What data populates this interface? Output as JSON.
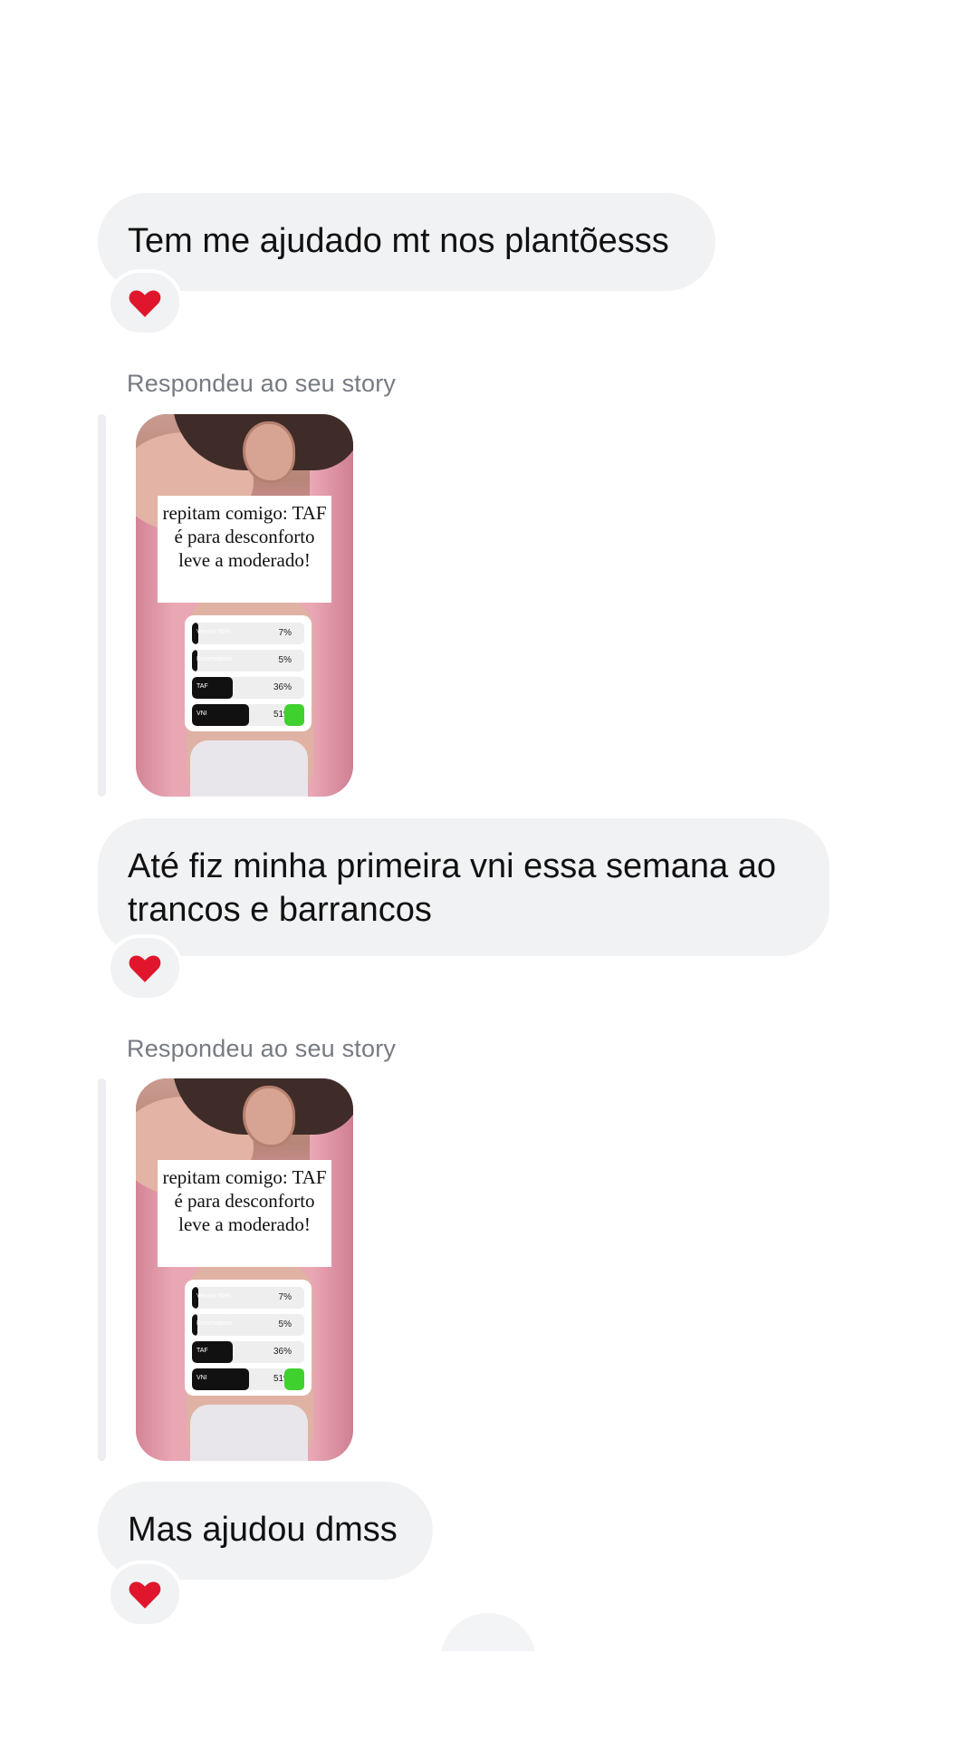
{
  "messages": [
    {
      "text": "Tem me ajudado mt nos plantõesss",
      "reaction": "heart-icon"
    },
    {
      "text": "Até fiz minha primeira vni essa semana ao trancos e barrancos",
      "reaction": "heart-icon"
    },
    {
      "text": "Mas ajudou dmss",
      "reaction": "heart-icon"
    }
  ],
  "story_replies": [
    {
      "label": "Respondeu ao seu story",
      "caption": "repitam comigo: TAF é para desconforto leve a moderado!",
      "poll": [
        {
          "label": "Venturi 50%",
          "percent": "7%",
          "value": 7
        },
        {
          "label": "Reservatório",
          "percent": "5%",
          "value": 5
        },
        {
          "label": "TAF",
          "percent": "36%",
          "value": 36
        },
        {
          "label": "VNI",
          "percent": "51%",
          "value": 51,
          "selected": true
        }
      ]
    },
    {
      "label": "Respondeu ao seu story",
      "caption": "repitam comigo: TAF é para desconforto leve a moderado!",
      "poll": [
        {
          "label": "Venturi 50%",
          "percent": "7%",
          "value": 7
        },
        {
          "label": "Reservatório",
          "percent": "5%",
          "value": 5
        },
        {
          "label": "TAF",
          "percent": "36%",
          "value": 36
        },
        {
          "label": "VNI",
          "percent": "51%",
          "value": 51,
          "selected": true
        }
      ]
    }
  ],
  "colors": {
    "bubble": "#f1f2f4",
    "heart": "#e0172c",
    "poll_check": "#3fd12e"
  }
}
